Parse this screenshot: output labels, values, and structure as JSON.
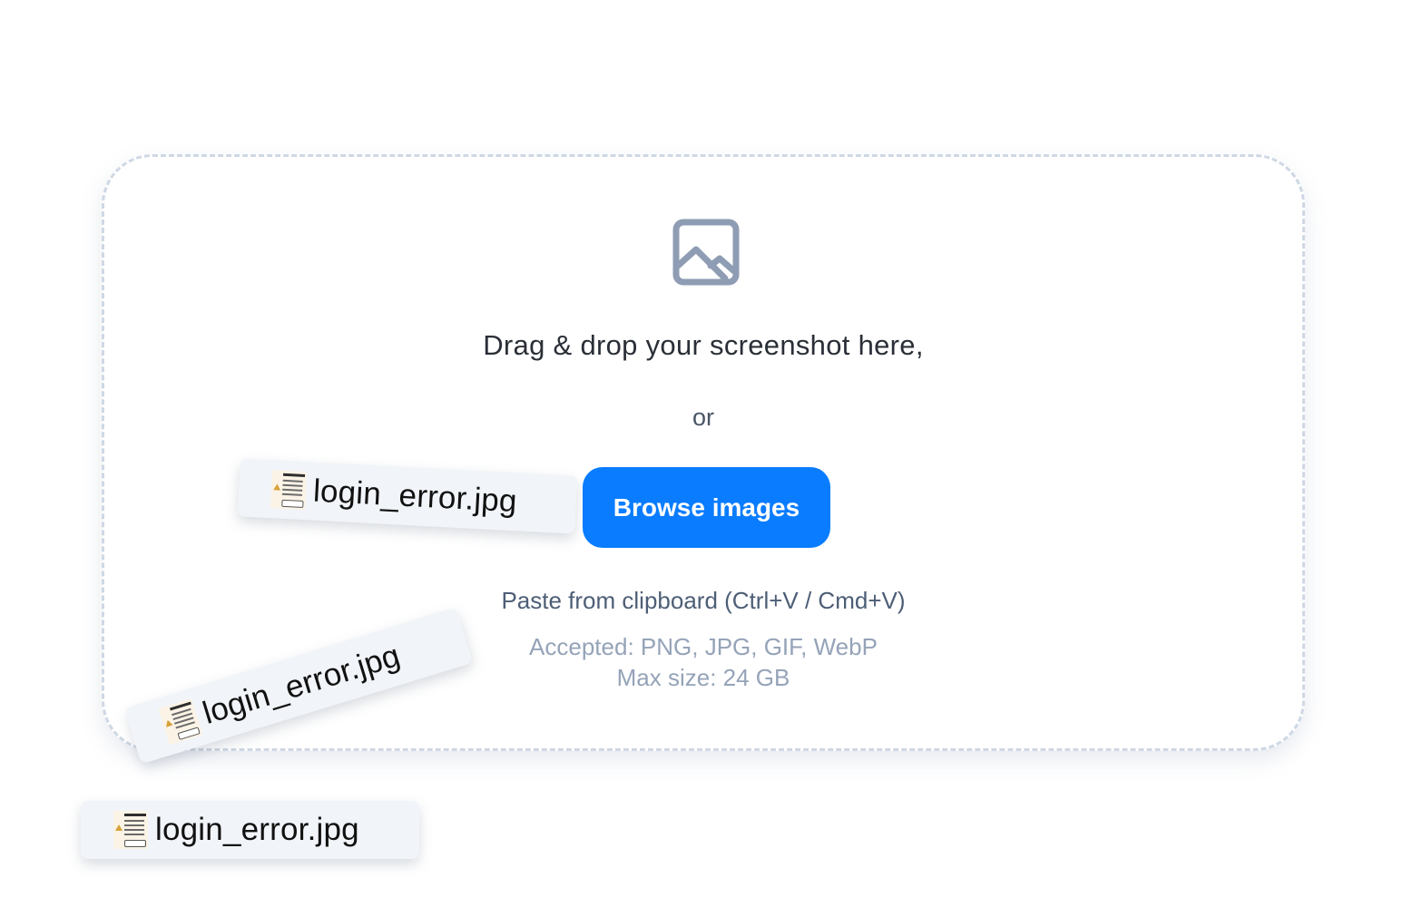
{
  "dropzone": {
    "icon": "image-icon",
    "headline": "Drag & drop your screenshot here,",
    "or_text": "or",
    "browse_label": "Browse images",
    "paste_hint": "Paste from clipboard (Ctrl+V / Cmd+V)",
    "accepted": "Accepted: PNG, JPG, GIF, WebP",
    "max_size": "Max size: 24 GB"
  },
  "dragged_files": [
    {
      "name": "login_error.jpg",
      "thumbnail_icon": "screenshot-thumbnail"
    },
    {
      "name": "login_error.jpg",
      "thumbnail_icon": "screenshot-thumbnail"
    },
    {
      "name": "login_error.jpg",
      "thumbnail_icon": "screenshot-thumbnail"
    }
  ],
  "colors": {
    "accent": "#0a7cff",
    "border": "#cfd8e4",
    "icon": "#8e9db3",
    "muted_text": "#95a3b8"
  }
}
